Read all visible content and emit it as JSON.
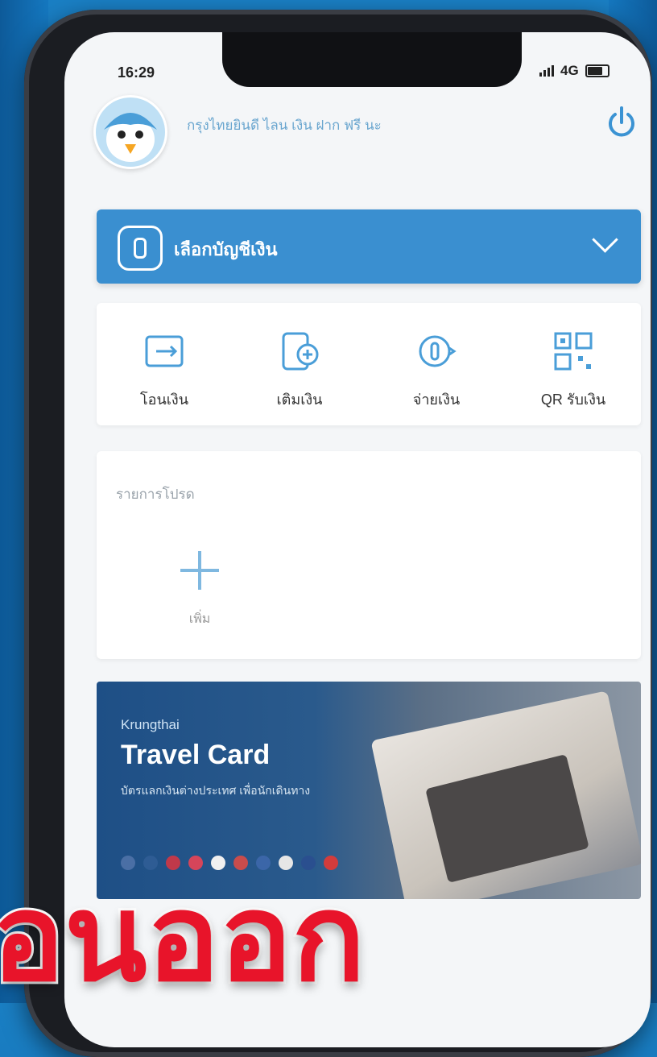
{
  "status": {
    "time": "16:29",
    "network": "4G"
  },
  "header": {
    "greeting": "กรุงไทยยินดี ไลน เงิน ฝาก ฟรี นะ"
  },
  "account": {
    "label": "เลือกบัญชีเงิน"
  },
  "quick_actions": [
    {
      "label": "โอนเงิน",
      "icon": "transfer-icon"
    },
    {
      "label": "เติมเงิน",
      "icon": "topup-icon"
    },
    {
      "label": "จ่ายเงิน",
      "icon": "pay-icon"
    },
    {
      "label": "QR รับเงิน",
      "icon": "qr-icon"
    }
  ],
  "favorites": {
    "title": "รายการโปรด",
    "add_label": "เพิ่ม"
  },
  "banner": {
    "brand": "Krungthai",
    "title": "Travel Card",
    "subtitle": "บัตรแลกเงินต่างประเทศ เพื่อนักเดินทาง"
  },
  "overlay": {
    "text": "อนออก"
  },
  "colors": {
    "primary": "#3a8fd0",
    "accent": "#3b93d3",
    "overlay": "#e8142a",
    "background": "#0d5f9e"
  }
}
